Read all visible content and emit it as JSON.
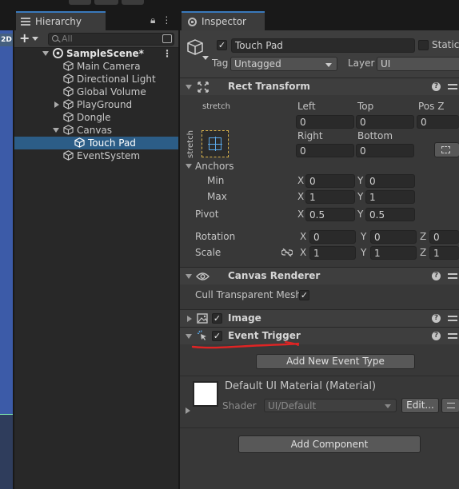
{
  "scene_view": {
    "mode_label": "2D"
  },
  "hierarchy": {
    "tab_label": "Hierarchy",
    "search_placeholder": "All",
    "scene_name": "SampleScene*",
    "items": [
      {
        "label": "Main Camera"
      },
      {
        "label": "Directional Light"
      },
      {
        "label": "Global Volume"
      },
      {
        "label": "PlayGround"
      },
      {
        "label": "Dongle"
      },
      {
        "label": "Canvas"
      },
      {
        "label": "Touch Pad"
      },
      {
        "label": "EventSystem"
      }
    ]
  },
  "inspector": {
    "tab_label": "Inspector",
    "object_name": "Touch Pad",
    "static_label": "Static",
    "tag_label": "Tag",
    "tag_value": "Untagged",
    "layer_label": "Layer",
    "layer_value": "UI",
    "rect_transform": {
      "title": "Rect Transform",
      "stretch_top": "stretch",
      "stretch_side": "stretch",
      "left_label": "Left",
      "left_value": "0",
      "top_label": "Top",
      "top_value": "0",
      "posz_label": "Pos Z",
      "posz_value": "0",
      "right_label": "Right",
      "right_value": "0",
      "bottom_label": "Bottom",
      "bottom_value": "0",
      "anchors_label": "Anchors",
      "min_label": "Min",
      "min_x": "0",
      "min_y": "0",
      "max_label": "Max",
      "max_x": "1",
      "max_y": "1",
      "pivot_label": "Pivot",
      "pivot_x": "0.5",
      "pivot_y": "0.5",
      "rotation_label": "Rotation",
      "rot_x": "0",
      "rot_y": "0",
      "rot_z": "0",
      "scale_label": "Scale",
      "scale_x": "1",
      "scale_y": "1",
      "scale_z": "1",
      "x": "X",
      "y": "Y",
      "z": "Z"
    },
    "canvas_renderer": {
      "title": "Canvas Renderer",
      "cull_label": "Cull Transparent Mesh"
    },
    "image": {
      "title": "Image"
    },
    "event_trigger": {
      "title": "Event Trigger",
      "add_button": "Add New Event Type"
    },
    "material": {
      "name": "Default UI Material (Material)",
      "shader_label": "Shader",
      "shader_value": "UI/Default",
      "edit_button": "Edit..."
    },
    "add_component_button": "Add Component"
  },
  "colors": {
    "selection": "#2c5d87",
    "accent_tab": "#3a79bb",
    "annotation_red": "#e02424"
  }
}
